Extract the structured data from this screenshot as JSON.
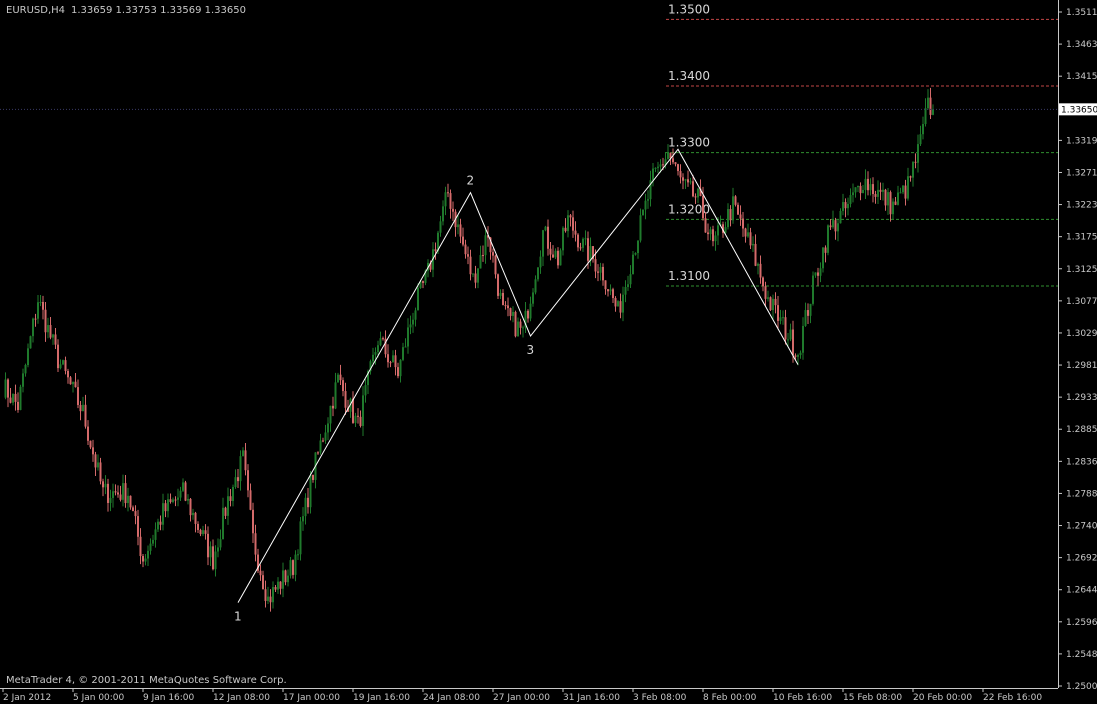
{
  "chart_header": {
    "symbol": "EURUSD,H4",
    "ohlc": "1.33659 1.33753 1.33569 1.33650"
  },
  "copyright": "MetaTrader 4, © 2001-2011 MetaQuotes Software Corp.",
  "colors": {
    "background": "#000000",
    "bull_candle": "#1f7a2c",
    "bear_candle": "#d46a6a",
    "axis": "#c8c8c8",
    "wave_line": "#ffffff",
    "level_red": "#c24646",
    "level_green": "#2f8f2f",
    "bid_line": "#3a3a66"
  },
  "chart_data": {
    "type": "candlestick",
    "price_axis_labels": [
      "1.35110",
      "1.34630",
      "1.34150",
      "1.33650",
      "1.33190",
      "1.32710",
      "1.32230",
      "1.31755",
      "1.31255",
      "1.30775",
      "1.30295",
      "1.29815",
      "1.29335",
      "1.28855",
      "1.28360",
      "1.27880",
      "1.27400",
      "1.26920",
      "1.26440",
      "1.25960",
      "1.25480",
      "1.25000"
    ],
    "price_range": [
      1.25,
      1.3511
    ],
    "current_price": "1.33650",
    "time_axis_labels": [
      "2 Jan 2012",
      "5 Jan 00:00",
      "9 Jan 16:00",
      "12 Jan 08:00",
      "17 Jan 00:00",
      "19 Jan 16:00",
      "24 Jan 08:00",
      "27 Jan 00:00",
      "31 Jan 16:00",
      "3 Feb 08:00",
      "8 Feb 00:00",
      "10 Feb 16:00",
      "15 Feb 08:00",
      "20 Feb 00:00",
      "22 Feb 16:00"
    ],
    "anchors": [
      [
        0,
        1.295
      ],
      [
        6,
        1.292
      ],
      [
        14,
        1.308
      ],
      [
        22,
        1.299
      ],
      [
        32,
        1.291
      ],
      [
        40,
        1.279
      ],
      [
        50,
        1.279
      ],
      [
        56,
        1.269
      ],
      [
        64,
        1.276
      ],
      [
        72,
        1.279
      ],
      [
        78,
        1.274
      ],
      [
        84,
        1.269
      ],
      [
        90,
        1.278
      ],
      [
        96,
        1.284
      ],
      [
        100,
        1.272
      ],
      [
        106,
        1.263
      ],
      [
        116,
        1.268
      ],
      [
        124,
        1.282
      ],
      [
        134,
        1.296
      ],
      [
        142,
        1.289
      ],
      [
        150,
        1.302
      ],
      [
        158,
        1.297
      ],
      [
        164,
        1.306
      ],
      [
        170,
        1.312
      ],
      [
        178,
        1.324
      ],
      [
        184,
        1.316
      ],
      [
        188,
        1.311
      ],
      [
        194,
        1.318
      ],
      [
        200,
        1.306
      ],
      [
        208,
        1.303
      ],
      [
        216,
        1.318
      ],
      [
        222,
        1.314
      ],
      [
        226,
        1.32
      ],
      [
        232,
        1.316
      ],
      [
        240,
        1.312
      ],
      [
        246,
        1.306
      ],
      [
        252,
        1.315
      ],
      [
        260,
        1.326
      ],
      [
        266,
        1.33
      ],
      [
        272,
        1.325
      ],
      [
        278,
        1.323
      ],
      [
        284,
        1.316
      ],
      [
        292,
        1.322
      ],
      [
        300,
        1.315
      ],
      [
        306,
        1.308
      ],
      [
        312,
        1.304
      ],
      [
        318,
        1.3
      ],
      [
        324,
        1.31
      ],
      [
        330,
        1.318
      ],
      [
        338,
        1.322
      ],
      [
        344,
        1.326
      ],
      [
        350,
        1.324
      ],
      [
        356,
        1.322
      ],
      [
        362,
        1.325
      ],
      [
        366,
        1.33
      ],
      [
        370,
        1.337
      ],
      [
        372,
        1.3365
      ]
    ],
    "levels": [
      {
        "label": "1.3500",
        "price": 1.35,
        "style": "red"
      },
      {
        "label": "1.3400",
        "price": 1.34,
        "style": "red"
      },
      {
        "label": "1.3300",
        "price": 1.33,
        "style": "green"
      },
      {
        "label": "1.3200",
        "price": 1.32,
        "style": "green"
      },
      {
        "label": "1.3100",
        "price": 1.31,
        "style": "green"
      }
    ],
    "wave_points": [
      {
        "label": "1",
        "bar": 94,
        "price": 1.2625
      },
      {
        "label": "2",
        "bar": 187,
        "price": 1.324
      },
      {
        "label": "3",
        "bar": 211,
        "price": 1.3025
      },
      {
        "label": "",
        "bar": 270,
        "price": 1.3305
      },
      {
        "label": "",
        "bar": 318,
        "price": 1.2982
      }
    ]
  }
}
